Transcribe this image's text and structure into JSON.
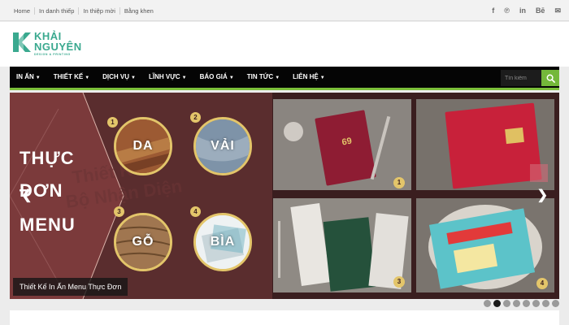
{
  "topbar": {
    "links": [
      "Home",
      "In danh thiếp",
      "In thiệp mời",
      "Bằng khen"
    ],
    "socials": [
      "f",
      "℗",
      "in",
      "Bē",
      "✉"
    ]
  },
  "logo": {
    "line1": "KHẢI",
    "line2": "NGUYÊN",
    "tagline": "DESIGN & PRINTING",
    "color": "#3aa98f"
  },
  "nav": {
    "items": [
      "IN ẤN",
      "THIẾT KẾ",
      "DỊCH VỤ",
      "LĨNH VỰC",
      "BÁO GIÁ",
      "TIN TỨC",
      "LIÊN HỆ"
    ],
    "search_placeholder": "Tìn kiếm",
    "accent": "#7cc03a"
  },
  "slider": {
    "title_words": [
      "THỰC",
      "ĐƠN",
      "MENU"
    ],
    "materials": [
      {
        "num": "1",
        "label": "DA"
      },
      {
        "num": "2",
        "label": "VẢI"
      },
      {
        "num": "3",
        "label": "GỖ"
      },
      {
        "num": "4",
        "label": "BÌA"
      }
    ],
    "photo_numbers": [
      "1",
      "2",
      "3",
      "4"
    ],
    "caption": "Thiết Kế In Ấn Menu Thực Đơn",
    "dot_count": 8,
    "active_dot": 1
  }
}
